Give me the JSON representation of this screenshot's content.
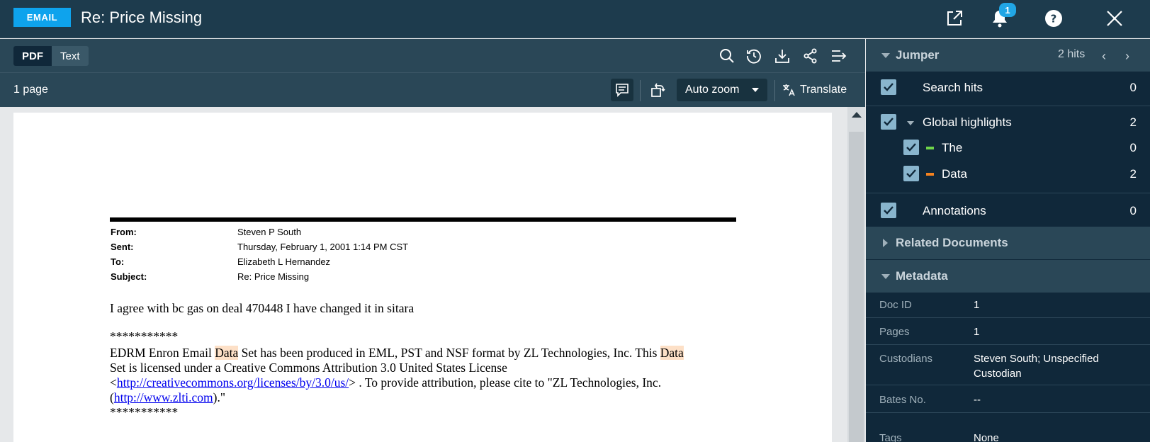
{
  "header": {
    "type_badge": "EMAIL",
    "title": "Re: Price Missing",
    "notification_count": "1"
  },
  "toolbar": {
    "view_options": [
      "PDF",
      "Text"
    ],
    "active_view": "PDF"
  },
  "subbar": {
    "page_count": "1 page",
    "zoom_value": "Auto zoom",
    "translate_label": "Translate"
  },
  "document": {
    "headers": [
      {
        "label": "From:",
        "value": "Steven P South"
      },
      {
        "label": "Sent:",
        "value": "Thursday, February 1, 2001 1:14 PM CST"
      },
      {
        "label": "To:",
        "value": "Elizabeth L Hernandez"
      },
      {
        "label": "Subject:",
        "value": "Re: Price Missing"
      }
    ],
    "body_line1": "I agree with bc gas  on deal 470448 I have changed  it in sitara",
    "stars": "***********",
    "line_a1": "EDRM Enron Email ",
    "highlight_word": "Data",
    "line_a2": " Set has been produced in EML, PST and NSF format by ZL Technologies, Inc. This ",
    "line_b": "Set is licensed under a Creative Commons Attribution 3.0 United States License",
    "line_c_pre": "<",
    "link1": "http://creativecommons.org/licenses/by/3.0/us/",
    "line_c_post": "> . To provide attribution, please cite to \"ZL Technologies, Inc.",
    "line_d_pre": "(",
    "link2": "http://www.zlti.com",
    "line_d_post": ").\"",
    "stars_end": "***********"
  },
  "panel": {
    "jumper": {
      "title": "Jumper",
      "hits": "2 hits"
    },
    "filters": [
      {
        "label": "Search hits",
        "count": "0"
      },
      {
        "label": "Global highlights",
        "count": "2"
      },
      {
        "label": "The",
        "count": "0",
        "color": "#6fd64a"
      },
      {
        "label": "Data",
        "count": "2",
        "color": "#f5821f"
      },
      {
        "label": "Annotations",
        "count": "0"
      }
    ],
    "related_title": "Related Documents",
    "metadata_title": "Metadata",
    "metadata": [
      {
        "label": "Doc ID",
        "value": "1"
      },
      {
        "label": "Pages",
        "value": "1"
      },
      {
        "label": "Custodians",
        "value": "Steven South; Unspecified Custodian"
      },
      {
        "label": "Bates No.",
        "value": "--"
      },
      {
        "label": "Tags",
        "value": "None"
      }
    ]
  },
  "colors": {
    "header_bg": "#1d3b4d",
    "toolbar_bg": "#2a4757",
    "panel_bg": "#10283a",
    "badge_blue": "#0ea3ed",
    "highlight": "#fde0c7"
  }
}
